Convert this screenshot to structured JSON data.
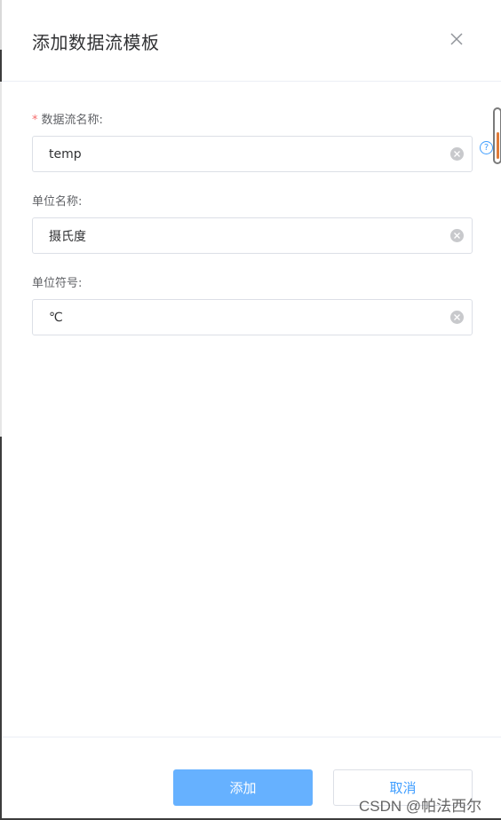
{
  "dialog": {
    "title": "添加数据流模板"
  },
  "form": {
    "fields": [
      {
        "label": "数据流名称:",
        "required_mark": "*",
        "value": "temp"
      },
      {
        "label": "单位名称:",
        "value": "摄氏度"
      },
      {
        "label": "单位符号:",
        "value": "℃"
      }
    ],
    "help_glyph": "?"
  },
  "footer": {
    "confirm_label": "添加",
    "cancel_label": "取消"
  },
  "watermark": {
    "text": "CSDN @帕法西尔"
  },
  "colors": {
    "primary": "#66b1ff",
    "link": "#409eff",
    "required": "#f56c6c",
    "scroll_thumb": "#e07b39"
  },
  "icons": {
    "close": "close-icon",
    "clear": "clear-icon",
    "help": "question-circle-icon"
  }
}
